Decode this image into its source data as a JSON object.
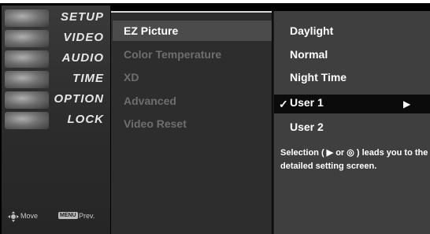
{
  "sidebar": {
    "categories": [
      "SETUP",
      "VIDEO",
      "AUDIO",
      "TIME",
      "OPTION",
      "LOCK"
    ],
    "footer": {
      "move_label": "Move",
      "menu_key": "MENU",
      "prev_label": "Prev."
    }
  },
  "settings": {
    "items": [
      "EZ Picture",
      "Color Temperature",
      "XD",
      "Advanced",
      "Video Reset"
    ],
    "active_index": 0
  },
  "options": {
    "items": [
      "Daylight",
      "Normal",
      "Night Time",
      "User 1",
      "User 2"
    ],
    "selected_index": 3,
    "check_mark": "✓",
    "arrow": "▶",
    "help_text": "Selection ( ▶ or ◎ ) leads you to the detailed setting screen."
  },
  "colors": {
    "background": "#000000",
    "settings_bg": "#2d2d2d",
    "options_bg": "#3f3f3f",
    "selected_row": "#0b0b0b",
    "dim_text": "#6e6e6e",
    "text": "#ffffff"
  }
}
